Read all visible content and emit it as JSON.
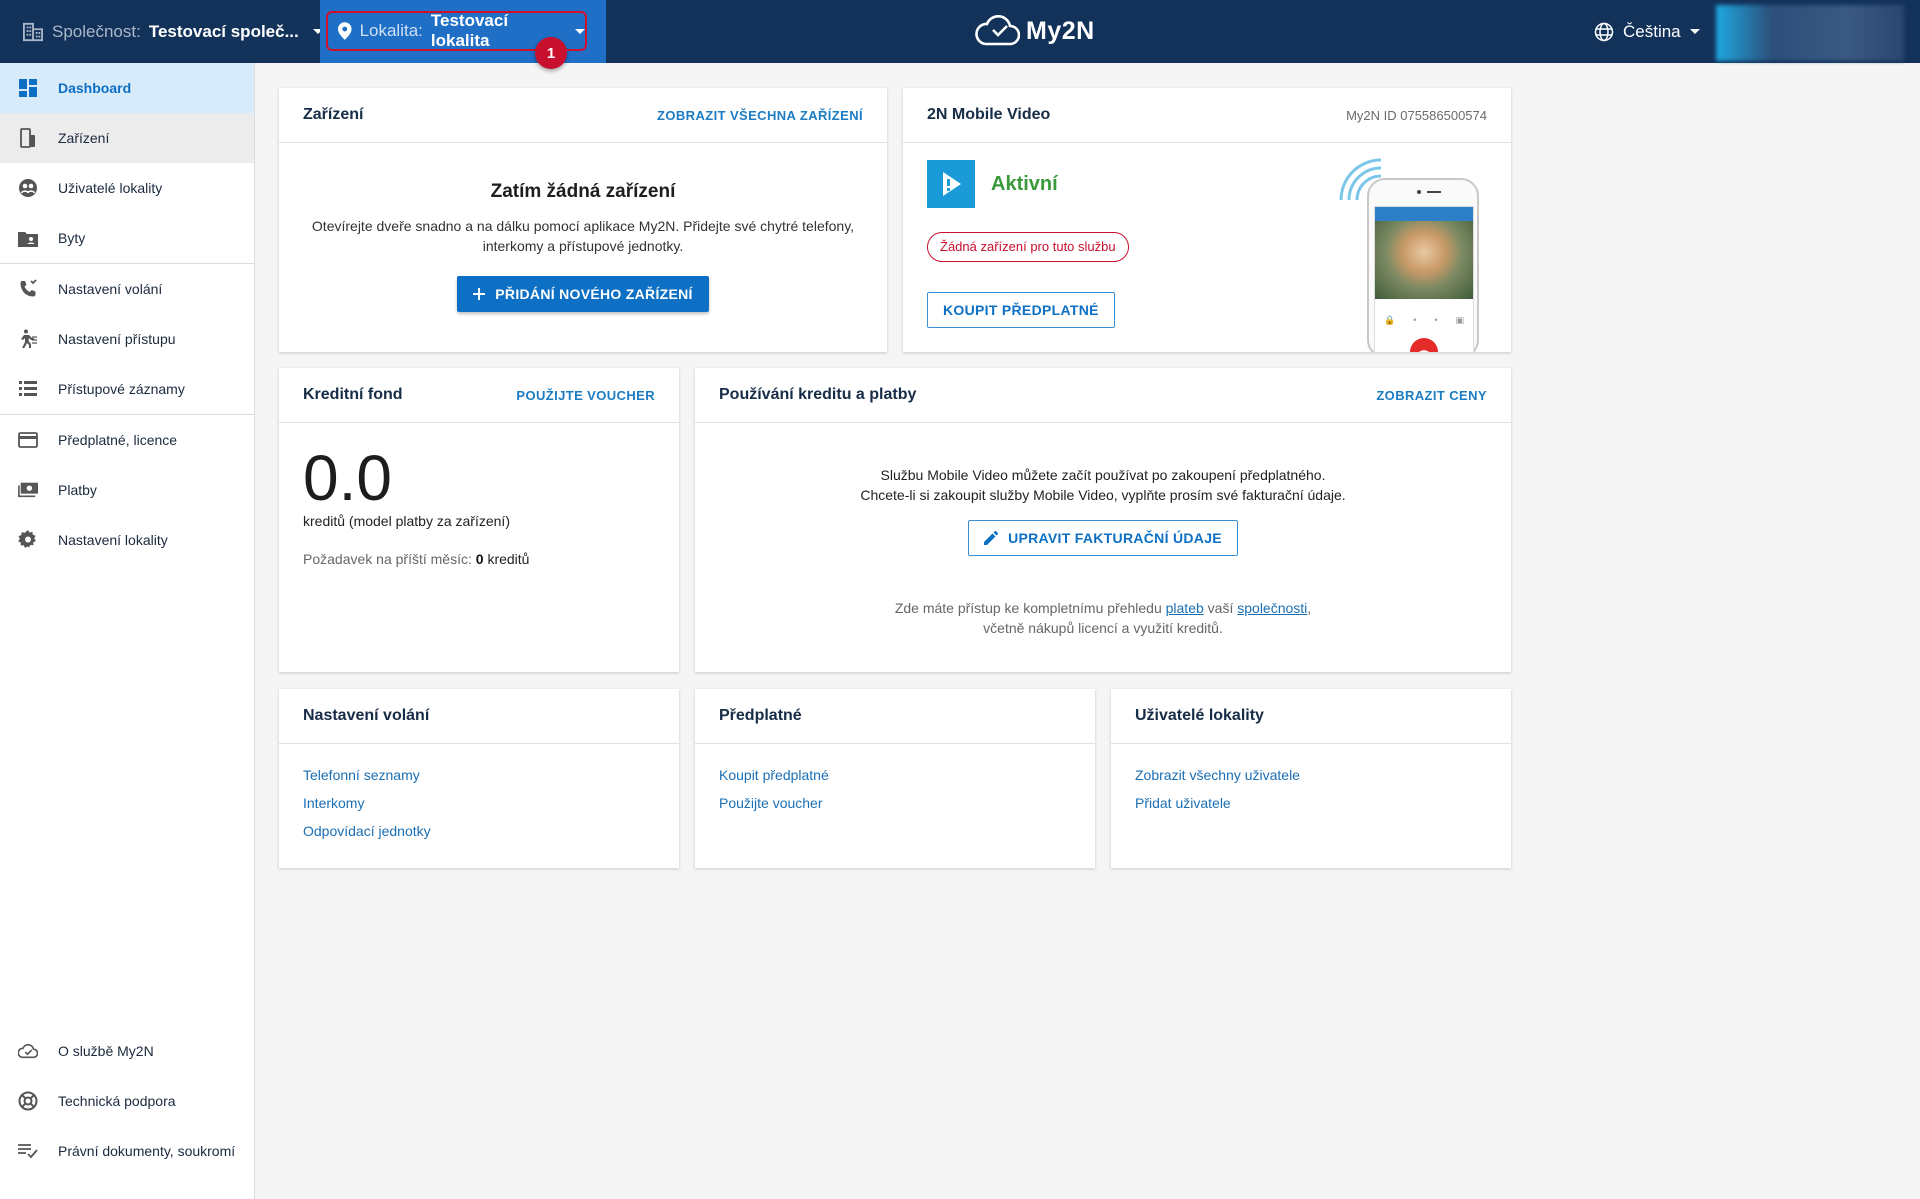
{
  "header": {
    "company_label": "Společnost:",
    "company_value": "Testovací společ...",
    "location_label": "Lokalita:",
    "location_value": "Testovací lokalita",
    "step_badge": "1",
    "logo_text": "My2N",
    "language": "Čeština"
  },
  "sidebar": {
    "items": [
      {
        "label": "Dashboard",
        "icon": "dashboard-icon"
      },
      {
        "label": "Zařízení",
        "icon": "devices-icon"
      },
      {
        "label": "Uživatelé lokality",
        "icon": "users-icon"
      },
      {
        "label": "Byty",
        "icon": "apartments-icon"
      },
      {
        "label": "Nastavení volání",
        "icon": "call-settings-icon"
      },
      {
        "label": "Nastavení přístupu",
        "icon": "access-icon"
      },
      {
        "label": "Přístupové záznamy",
        "icon": "access-log-icon"
      },
      {
        "label": "Předplatné, licence",
        "icon": "credit-card-icon"
      },
      {
        "label": "Platby",
        "icon": "payments-icon"
      },
      {
        "label": "Nastavení lokality",
        "icon": "gear-icon"
      }
    ],
    "bottom_items": [
      {
        "label": "O službě My2N",
        "icon": "cloud-icon"
      },
      {
        "label": "Technická podpora",
        "icon": "support-icon"
      },
      {
        "label": "Právní dokumenty, soukromí",
        "icon": "legal-icon"
      }
    ]
  },
  "devices_card": {
    "title": "Zařízení",
    "action": "ZOBRAZIT VŠECHNA ZAŘÍZENÍ",
    "empty_title": "Zatím žádná zařízení",
    "empty_text": "Otevírejte dveře snadno a na dálku pomocí aplikace My2N. Přidejte své chytré telefony, interkomy a přístupové jednotky.",
    "add_button": "PŘIDÁNÍ NOVÉHO ZAŘÍZENÍ"
  },
  "mobile_video_card": {
    "title": "2N Mobile Video",
    "my2n_id": "My2N ID 075586500574",
    "status": "Aktivní",
    "no_devices_badge": "Žádná zařízení pro tuto službu",
    "buy_button": "KOUPIT PŘEDPLATNÉ",
    "status_color": "#3a9a3a"
  },
  "credit_card": {
    "title": "Kreditní fond",
    "action": "POUŽIJTE VOUCHER",
    "value": "0.0",
    "unit_text": "kreditů (model platby za zařízení)",
    "next_month_label": "Požadavek na příští měsíc:",
    "next_month_value": "0",
    "next_month_unit": "kreditů"
  },
  "usage_card": {
    "title": "Používání kreditu a platby",
    "action": "ZOBRAZIT CENY",
    "line1": "Službu Mobile Video můžete začít používat po zakoupení předplatného.",
    "line2": "Chcete-li si zakoupit služby Mobile Video, vyplňte prosím své fakturační údaje.",
    "edit_button": "UPRAVIT FAKTURAČNÍ ÚDAJE",
    "footer_pre": "Zde máte přístup ke kompletnímu přehledu",
    "footer_link1": "plateb",
    "footer_mid": "vaší",
    "footer_link2": "společnosti",
    "footer_post": ",",
    "footer_line2": "včetně nákupů licencí a využití kreditů."
  },
  "call_settings_card": {
    "title": "Nastavení volání",
    "links": [
      "Telefonní seznamy",
      "Interkomy",
      "Odpovídací jednotky"
    ]
  },
  "subscription_card": {
    "title": "Předplatné",
    "links": [
      "Koupit předplatné",
      "Použijte voucher"
    ]
  },
  "site_users_card": {
    "title": "Uživatelé lokality",
    "links": [
      "Zobrazit všechny uživatele",
      "Přidat uživatele"
    ]
  },
  "colors": {
    "topbar": "#12325a",
    "accent": "#0d70c4",
    "location_bg": "#1f6fc7",
    "highlight": "#d0102a"
  }
}
